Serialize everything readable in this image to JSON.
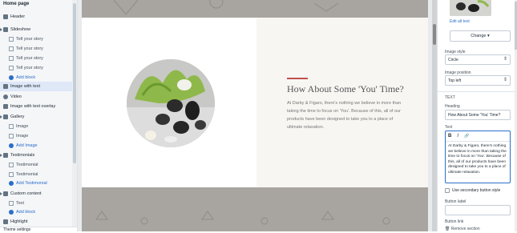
{
  "sidebar": {
    "title": "Home page",
    "header": "Header",
    "slideshow": {
      "label": "Slideshow",
      "items": [
        "Tell your story",
        "Tell your story",
        "Tell your story",
        "Tell your story"
      ],
      "add": "Add block"
    },
    "image_with_text": "Image with text",
    "video": "Video",
    "image_with_text_overlay": "Image with text overlay",
    "gallery": {
      "label": "Gallery",
      "items": [
        "Image",
        "Image"
      ],
      "add": "Add Image"
    },
    "testimonials": {
      "label": "Testimonials",
      "items": [
        "Testimonial",
        "Testimonial"
      ],
      "add": "Add Testimonial"
    },
    "custom_content": {
      "label": "Custom content",
      "items": [
        "Text"
      ],
      "add": "Add block"
    },
    "highlight": "Highlight",
    "footer": "Theme settings"
  },
  "preview": {
    "heading": "How About Some 'You' Time?",
    "body": "At Darby & Figaro, there's nothing we believe in more than taking the time to focus on 'You'. Because of this, all of our products have been designed to take you to a place of ultimate relaxation."
  },
  "panel": {
    "edit_alt": "Edit alt text",
    "change_btn": "Change ▾",
    "image_style_label": "Image style",
    "image_style_value": "Circle",
    "image_position_label": "Image position",
    "image_position_value": "Top left",
    "text_section": "TEXT",
    "heading_label": "Heading",
    "heading_value": "How About Some 'You' Time?",
    "text_label": "Text",
    "bold": "B",
    "italic": "I",
    "link_icon": "🔗",
    "text_value": "At Darby & Figaro, there's nothing we believe in more than taking the time to focus on 'You'. Because of this, all of our products have been designed to take you to a place of ultimate relaxation.",
    "secondary_btn_label": "Use secondary button style",
    "button_label_label": "Button label",
    "button_link_label": "Button link",
    "remove_section": "Remove section"
  },
  "colors": {
    "accent": "#c0504d",
    "link": "#2c6ecb",
    "band": "#a8a5a0"
  }
}
